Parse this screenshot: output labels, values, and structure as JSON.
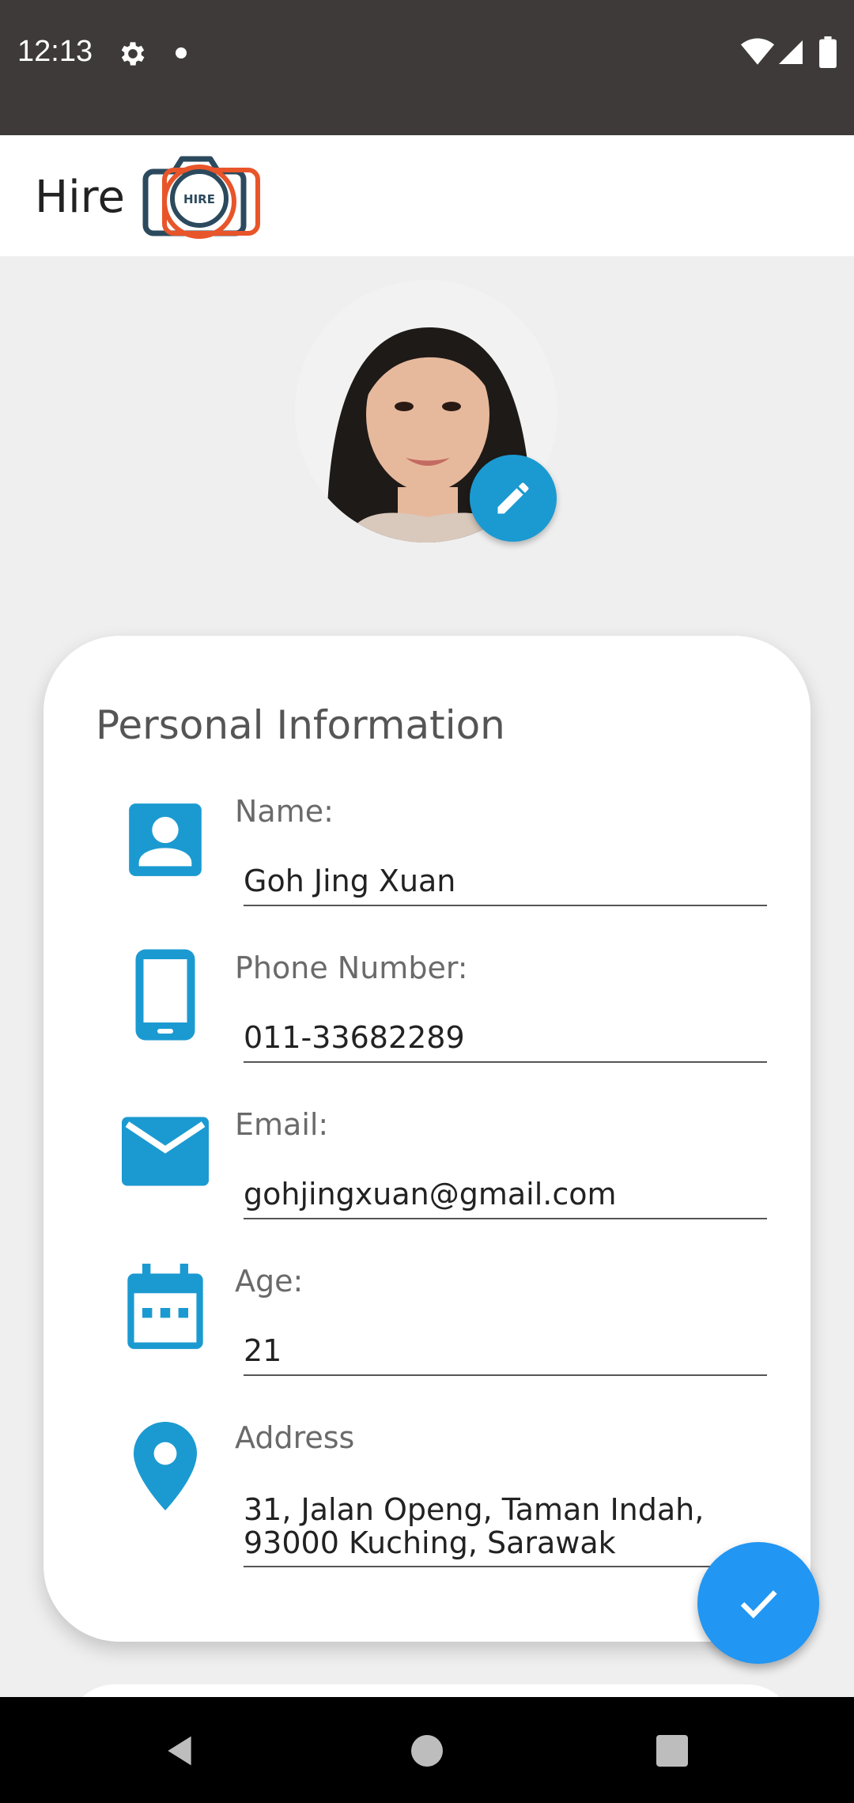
{
  "status_bar": {
    "time": "12:13",
    "icons": [
      "gear-icon",
      "notification-dot",
      "wifi-icon",
      "signal-icon",
      "battery-icon"
    ]
  },
  "app_bar": {
    "title": "Hire",
    "logo_text": "HIRE",
    "logo_icon": "camera-icon"
  },
  "profile": {
    "avatar": "profile-photo",
    "edit_icon": "pencil-icon"
  },
  "personal_info": {
    "title": "Personal Information",
    "fields": [
      {
        "icon": "contact-card-icon",
        "label": "Name:",
        "value": "Goh Jing Xuan"
      },
      {
        "icon": "phone-icon",
        "label": "Phone Number:",
        "value": "011-33682289"
      },
      {
        "icon": "email-icon",
        "label": "Email:",
        "value": "gohjingxuan@gmail.com"
      },
      {
        "icon": "calendar-icon",
        "label": "Age:",
        "value": "21"
      },
      {
        "icon": "location-pin-icon",
        "label": "Address",
        "value": "31, Jalan Openg, Taman Indah,\n93000 Kuching, Sarawak"
      }
    ]
  },
  "save_button": {
    "icon": "checkmark-icon"
  },
  "nav_bar": {
    "icons": [
      "back-icon",
      "home-icon",
      "recents-icon"
    ]
  },
  "colors": {
    "accent": "#1b9ad1",
    "fab": "#2196f3",
    "status_bar": "#3f3a3a",
    "logo_dark": "#2c4a5e",
    "logo_orange": "#e8552a"
  }
}
